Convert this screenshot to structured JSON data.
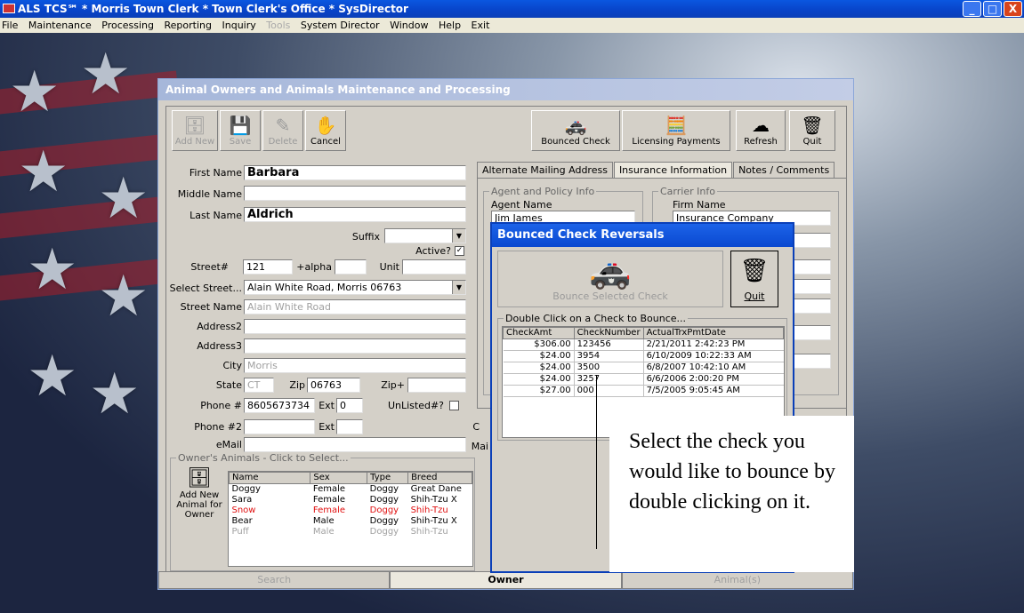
{
  "window": {
    "title": "ALS TCS℠ * Morris Town Clerk * Town Clerk's Office * SysDirector",
    "controls": [
      "_",
      "□",
      "X"
    ]
  },
  "menu": {
    "items": [
      "File",
      "Maintenance",
      "Processing",
      "Reporting",
      "Inquiry",
      "Tools",
      "System Director",
      "Window",
      "Help",
      "Exit"
    ]
  },
  "form": {
    "title": "Animal Owners and Animals Maintenance and Processing",
    "toolbar": {
      "add_new": "Add New",
      "save": "Save",
      "delete": "Delete",
      "cancel": "Cancel",
      "bounced_check": "Bounced Check",
      "licensing_payments": "Licensing Payments",
      "refresh": "Refresh",
      "quit": "Quit"
    },
    "fields": {
      "first_name_label": "First Name",
      "first_name": "Barbara",
      "middle_name_label": "Middle Name",
      "middle_name": "",
      "last_name_label": "Last Name",
      "last_name": "Aldrich",
      "suffix_label": "Suffix",
      "suffix": "",
      "active_label": "Active?",
      "street_no_label": "Street#",
      "street_no": "121",
      "alpha_label": "+alpha",
      "alpha": "",
      "unit_label": "Unit",
      "unit": "",
      "select_street_label": "Select Street...",
      "select_street": "Alain White Road, Morris 06763",
      "street_name_label": "Street Name",
      "street_name": "Alain White Road",
      "address2_label": "Address2",
      "address2": "",
      "address3_label": "Address3",
      "address3": "",
      "city_label": "City",
      "city": "Morris",
      "state_label": "State",
      "state": "CT",
      "zip_label": "Zip",
      "zip": "06763",
      "zipplus_label": "Zip+",
      "zipplus": "",
      "phone_label": "Phone #",
      "phone": "8605673734",
      "ext_label": "Ext",
      "ext": "0",
      "unlisted_label": "UnListed#?",
      "phone2_label": "Phone #2",
      "phone2": "",
      "ext2_label": "Ext",
      "ext2": "",
      "email_label": "eMail",
      "email": ""
    },
    "tabs": [
      "Alternate Mailing Address",
      "Insurance Information",
      "Notes / Comments"
    ],
    "insurance": {
      "agent_group": "Agent and Policy Info",
      "agent_name_label": "Agent Name",
      "agent_name": "Jim James",
      "carrier_group": "Carrier Info",
      "firm_name_label": "Firm Name",
      "firm_name": "Insurance Company"
    },
    "partial_labels": {
      "o": "C",
      "mai": "Mai"
    },
    "animals": {
      "group_title": "Owner's Animals - Click to Select...",
      "add_button": "Add New Animal for Owner",
      "columns": [
        "Name",
        "Sex",
        "Type",
        "Breed"
      ],
      "rows": [
        {
          "name": "Doggy",
          "sex": "Female",
          "type": "Doggy",
          "breed": "Great Dane",
          "style": "normal"
        },
        {
          "name": "Sara",
          "sex": "Female",
          "type": "Doggy",
          "breed": "Shih-Tzu X",
          "style": "normal"
        },
        {
          "name": "Snow",
          "sex": "Female",
          "type": "Doggy",
          "breed": "Shih-Tzu",
          "style": "red"
        },
        {
          "name": "Bear",
          "sex": "Male",
          "type": "Doggy",
          "breed": "Shih-Tzu X",
          "style": "normal"
        },
        {
          "name": "Puff",
          "sex": "Male",
          "type": "Doggy",
          "breed": "Shih-Tzu",
          "style": "gray"
        }
      ]
    },
    "bottom_tabs": [
      "Search",
      "Owner",
      "Animal(s)"
    ]
  },
  "dialog": {
    "title": "Bounced Check Reversals",
    "bounce_button": "Bounce Selected Check",
    "quit": "Quit",
    "group_title": "Double Click on a Check to Bounce...",
    "columns": [
      "CheckAmt",
      "CheckNumber",
      "ActualTrxPmtDate"
    ],
    "rows": [
      {
        "amt": "$306.00",
        "num": "123456",
        "date": "2/21/2011 2:42:23 PM"
      },
      {
        "amt": "$24.00",
        "num": "3954",
        "date": "6/10/2009 10:22:33 AM"
      },
      {
        "amt": "$24.00",
        "num": "3500",
        "date": "6/8/2007 10:42:10 AM"
      },
      {
        "amt": "$24.00",
        "num": "3257",
        "date": "6/6/2006 2:00:20 PM"
      },
      {
        "amt": "$27.00",
        "num": "000",
        "date": "7/5/2005 9:05:45 AM"
      }
    ]
  },
  "callout": {
    "text": "Select the check you would like to bounce by double clicking on it."
  }
}
